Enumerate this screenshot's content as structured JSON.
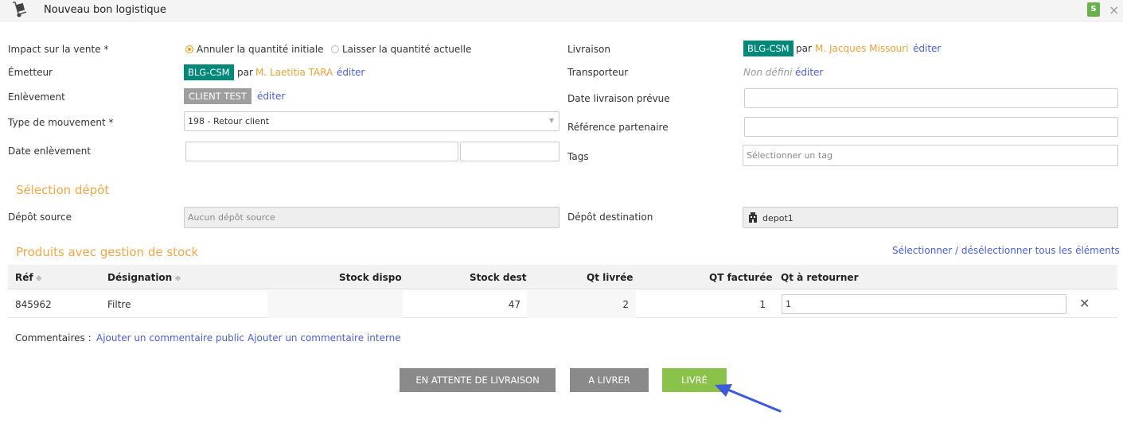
{
  "window": {
    "title": "Nouveau bon logistique",
    "badge": "S",
    "close": "×"
  },
  "form": {
    "impact_label": "Impact sur la vente *",
    "impact_option1": "Annuler la quantité initiale",
    "impact_option2": "Laisser la quantité actuelle",
    "emetteur_label": "Émetteur",
    "emetteur_tag": "BLG-CSM",
    "emetteur_par": "par",
    "emetteur_person": "M. Laetitia TARA",
    "emetteur_edit": "éditer",
    "enlevement_label": "Enlèvement",
    "enlevement_tag": "CLIENT TEST",
    "enlevement_edit": "éditer",
    "type_mvt_label": "Type de mouvement *",
    "type_mvt_value": "198 - Retour client",
    "date_enlevement_label": "Date enlèvement",
    "livraison_label": "Livraison",
    "livraison_tag": "BLG-CSM",
    "livraison_par": "par",
    "livraison_person": "M. Jacques Missouri",
    "livraison_edit": "éditer",
    "transporteur_label": "Transporteur",
    "transporteur_value": "Non défini",
    "transporteur_edit": "éditer",
    "date_livraison_label": "Date livraison prévue",
    "ref_partenaire_label": "Référence partenaire",
    "tags_label": "Tags",
    "tags_placeholder": "Sélectionner un tag"
  },
  "depot": {
    "section_title": "Sélection dépôt",
    "source_label": "Dépôt source",
    "source_placeholder": "Aucun dépôt source",
    "dest_label": "Dépôt destination",
    "dest_value": "depot1"
  },
  "products": {
    "section_title": "Produits avec gestion de stock",
    "select_all": "Sélectionner / désélectionner tous les éléments",
    "columns": {
      "ref": "Réf",
      "designation": "Désignation",
      "stock_dispo": "Stock dispo",
      "stock_dest": "Stock dest",
      "qt_livree": "Qt livrée",
      "qt_facturee": "QT facturée",
      "qt_retourner": "Qt à retourner"
    },
    "rows": [
      {
        "ref": "845962",
        "designation": "Filtre",
        "stock_dispo": "",
        "stock_dest": "47",
        "qt_livree": "2",
        "qt_facturee": "1",
        "qt_retourner": "1"
      }
    ]
  },
  "comments": {
    "label": "Commentaires :",
    "public": "Ajouter un commentaire public",
    "interne": "Ajouter un commentaire interne"
  },
  "actions": {
    "attente": "EN ATTENTE DE LIVRAISON",
    "a_livrer": "A LIVRER",
    "livre": "LIVRÉ"
  },
  "colors": {
    "teal": "#00897b",
    "orange": "#f0a64a",
    "link": "#4a5fd5",
    "green": "#8bc34a",
    "arrow": "#3b5bdb"
  }
}
